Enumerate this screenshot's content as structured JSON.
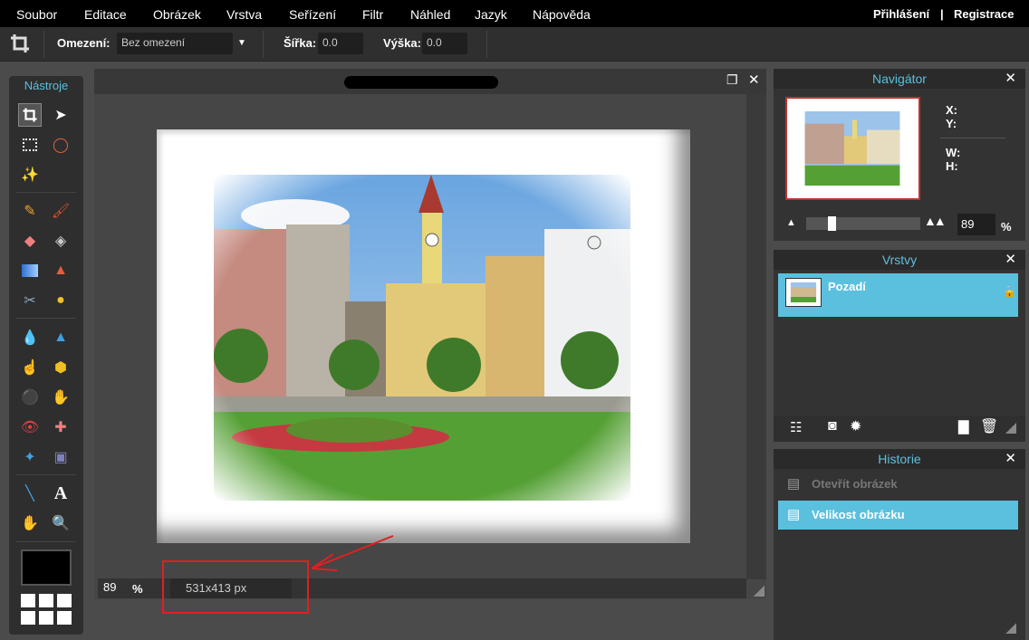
{
  "menu": [
    "Soubor",
    "Editace",
    "Obrázek",
    "Vrstva",
    "Seřízení",
    "Filtr",
    "Náhled",
    "Jazyk",
    "Nápověda"
  ],
  "auth": {
    "login": "Přihlášení",
    "sep": "|",
    "register": "Registrace"
  },
  "options": {
    "constraint_label": "Omezení:",
    "constraint_value": "Bez omezení",
    "width_label": "Šířka:",
    "width_value": "0.0",
    "height_label": "Výška:",
    "height_value": "0.0"
  },
  "tools": {
    "title": "Nástroje"
  },
  "status": {
    "zoom": "89",
    "zoom_unit": "%",
    "size": "531x413 px"
  },
  "navigator": {
    "title": "Navigátor",
    "x": "X:",
    "y": "Y:",
    "w": "W:",
    "h": "H:",
    "zoom": "89",
    "zoom_unit": "%"
  },
  "layers": {
    "title": "Vrstvy",
    "items": [
      {
        "name": "Pozadí"
      }
    ]
  },
  "history": {
    "title": "Historie",
    "items": [
      {
        "label": "Otevřít obrázek"
      },
      {
        "label": "Velikost obrázku"
      }
    ]
  },
  "colors": {
    "accent": "#5bc0de",
    "annotation": "#e02020"
  }
}
